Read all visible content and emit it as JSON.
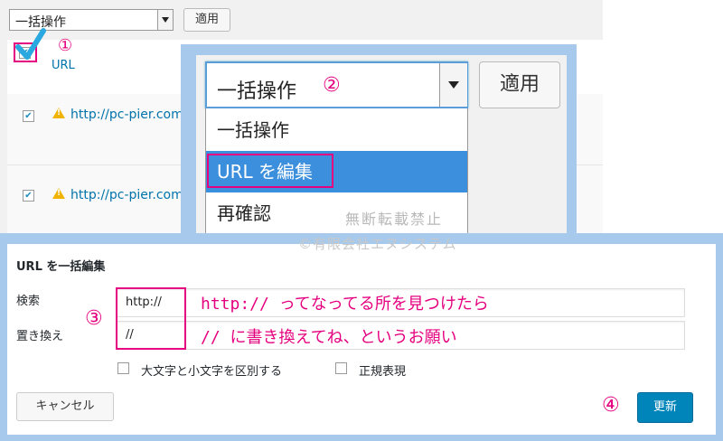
{
  "bulk_actions": {
    "select_value": "一括操作",
    "apply_label": "適用"
  },
  "list": {
    "header_link": "URL",
    "rows": [
      {
        "url": "http://pc-pier.com"
      },
      {
        "url": "http://pc-pier.com"
      }
    ]
  },
  "zoom": {
    "select_value": "一括操作",
    "apply_label": "適用",
    "options": [
      "一括操作",
      "URL を編集",
      "再確認"
    ],
    "selected_option": "URL を編集"
  },
  "annotations": {
    "step1": "①",
    "step2": "②",
    "step3": "③",
    "step4": "④",
    "note_search": "http:// ってなってる所を見つけたら",
    "note_replace": "// に書き換えてね、というお願い",
    "watermark": "無断転載禁止",
    "copyright": "©有限会社エヌシステム"
  },
  "bulk_edit": {
    "title": "URL を一括編集",
    "search_label": "検索",
    "search_value": "http://",
    "replace_label": "置き換え",
    "replace_value": "//",
    "case_sensitive_label": "大文字と小文字を区別する",
    "regex_label": "正規表現",
    "cancel_label": "キャンセル",
    "update_label": "更新"
  },
  "colors": {
    "accent_pink": "#e5007f",
    "highlight_blue": "#3c8fdc",
    "panel_blue": "#a6c9ec",
    "primary_button": "#0085ba",
    "link": "#0073aa"
  }
}
